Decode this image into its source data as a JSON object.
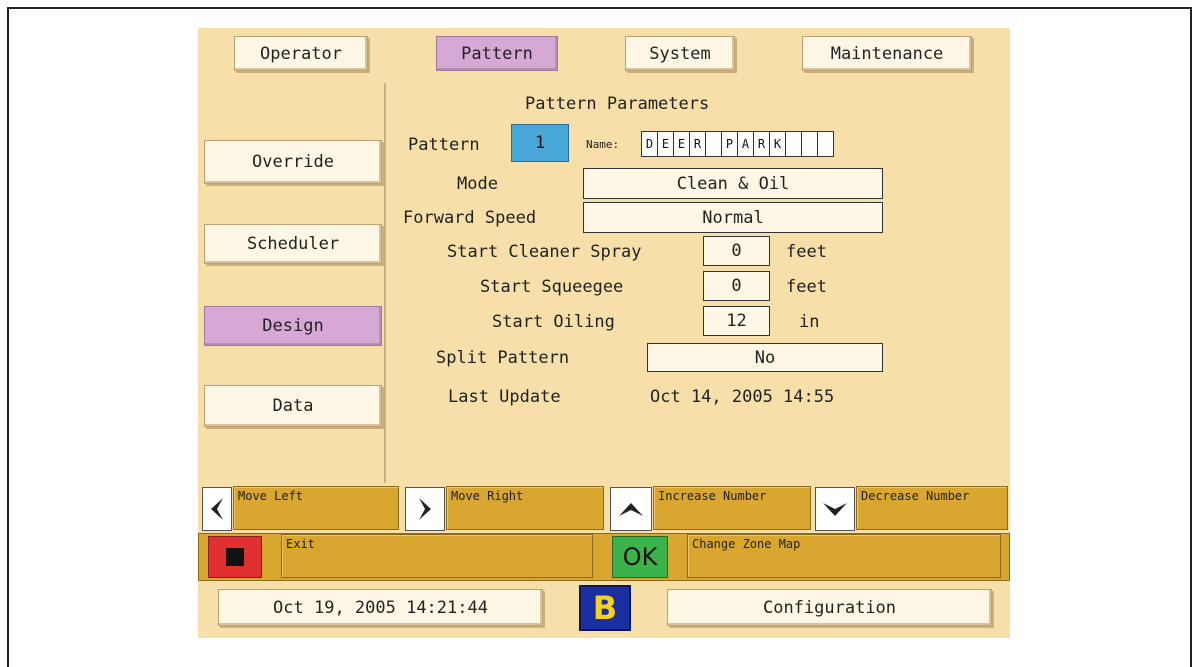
{
  "top_tabs": [
    "Operator",
    "Pattern",
    "System",
    "Maintenance"
  ],
  "active_tab": "Pattern",
  "side_menu": [
    "Override",
    "Scheduler",
    "Design",
    "Data"
  ],
  "active_side": "Design",
  "params": {
    "title": "Pattern Parameters",
    "pattern_label": "Pattern",
    "pattern_number": "1",
    "name_label": "Name:",
    "name_chars": [
      "D",
      "E",
      "E",
      "R",
      "",
      "P",
      "A",
      "R",
      "K",
      "",
      "",
      ""
    ],
    "mode_label": "Mode",
    "mode_value": "Clean & Oil",
    "forward_speed_label": "Forward Speed",
    "forward_speed_value": "Normal",
    "start_cleaner_label": "Start Cleaner Spray",
    "start_cleaner_value": "0",
    "start_cleaner_unit": "feet",
    "start_squeegee_label": "Start Squeegee",
    "start_squeegee_value": "0",
    "start_squeegee_unit": "feet",
    "start_oiling_label": "Start Oiling",
    "start_oiling_value": "12",
    "start_oiling_unit": "in",
    "split_label": "Split Pattern",
    "split_value": "No",
    "last_update_label": "Last Update",
    "last_update_value": "Oct 14, 2005 14:55"
  },
  "hints": {
    "move_left": "Move Left",
    "move_right": "Move Right",
    "increase": "Increase Number",
    "decrease": "Decrease Number",
    "exit": "Exit",
    "ok_label": "OK",
    "change_zone": "Change Zone Map"
  },
  "footer": {
    "datetime": "Oct 19, 2005 14:21:44",
    "logo": "B",
    "config": "Configuration"
  },
  "colors": {
    "panel": "#f6dfa8",
    "active": "#d7a8d6",
    "pattern_number_bg": "#4aa8d8",
    "hint": "#d9a630",
    "stop": "#e03030",
    "ok": "#3cb34a",
    "logo_bg": "#1c2fa0",
    "logo_fg": "#f5d21c"
  }
}
